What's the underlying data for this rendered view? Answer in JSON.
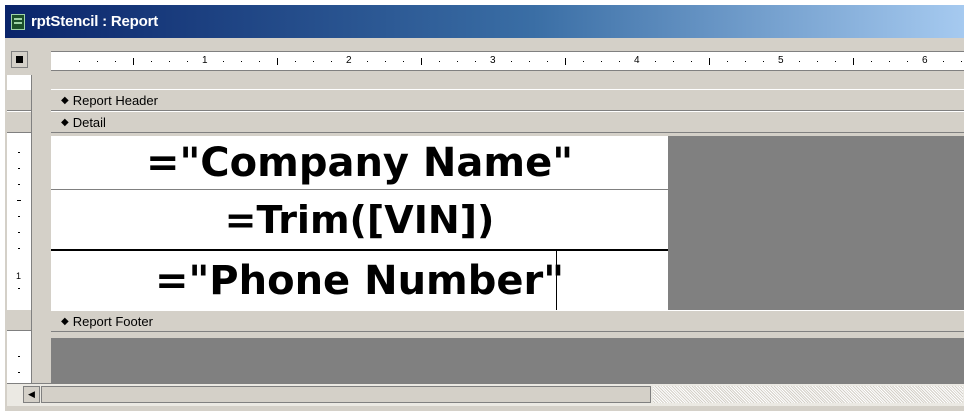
{
  "window": {
    "title": "rptStencil : Report"
  },
  "ruler": {
    "numbers": [
      "1",
      "2",
      "3",
      "4",
      "5",
      "6"
    ],
    "vertical_number": "1"
  },
  "sections": {
    "report_header": "Report Header",
    "detail": "Detail",
    "report_footer": "Report Footer"
  },
  "fields": {
    "company": "=\"Company Name\"",
    "vin": "=Trim([VIN])",
    "phone": "=\"Phone Number\""
  },
  "icons": {
    "title": "report-icon",
    "section": "section-arrow-icon",
    "scroll_left": "scroll-left-arrow-icon"
  }
}
